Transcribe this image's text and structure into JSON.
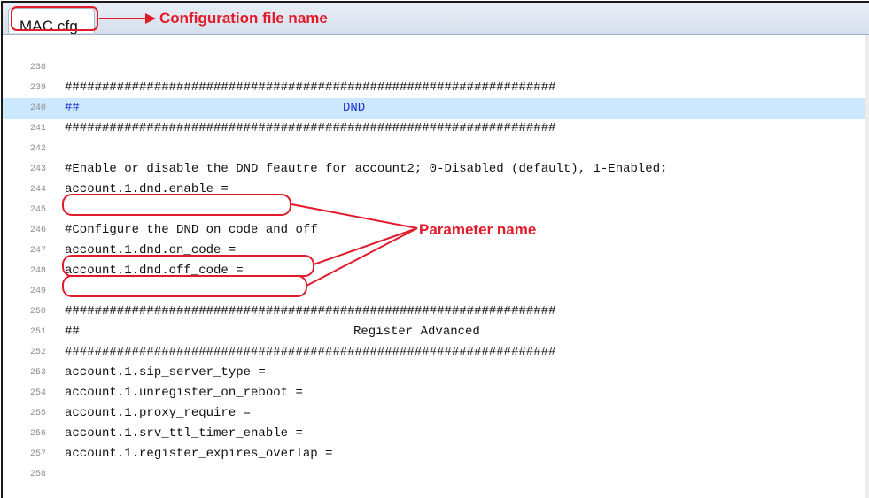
{
  "tab": {
    "file_name": "MAC.cfg"
  },
  "annotations": {
    "config_label": "Configuration file name",
    "param_label": "Parameter name",
    "accent_color": "#e21b2b"
  },
  "editor": {
    "lines": [
      {
        "num": "238",
        "text": ""
      },
      {
        "num": "239",
        "text": "##################################################################"
      },
      {
        "num": "240",
        "text": "##",
        "title": "DND",
        "highlight": true
      },
      {
        "num": "241",
        "text": "##################################################################"
      },
      {
        "num": "242",
        "text": ""
      },
      {
        "num": "243",
        "text": "#Enable or disable the DND feautre for account2; 0-Disabled (default), 1-Enabled;"
      },
      {
        "num": "244",
        "text": "account.1.dnd.enable ="
      },
      {
        "num": "245",
        "text": ""
      },
      {
        "num": "246",
        "text": "#Configure the DND on code and off"
      },
      {
        "num": "247",
        "text": "account.1.dnd.on_code ="
      },
      {
        "num": "248",
        "text": "account.1.dnd.off_code ="
      },
      {
        "num": "249",
        "text": ""
      },
      {
        "num": "250",
        "text": "##################################################################"
      },
      {
        "num": "251",
        "text": "##",
        "title": "Register Advanced"
      },
      {
        "num": "252",
        "text": "##################################################################"
      },
      {
        "num": "253",
        "text": "account.1.sip_server_type ="
      },
      {
        "num": "254",
        "text": "account.1.unregister_on_reboot ="
      },
      {
        "num": "255",
        "text": "account.1.proxy_require ="
      },
      {
        "num": "256",
        "text": "account.1.srv_ttl_timer_enable ="
      },
      {
        "num": "257",
        "text": "account.1.register_expires_overlap ="
      },
      {
        "num": "258",
        "text": ""
      }
    ]
  }
}
